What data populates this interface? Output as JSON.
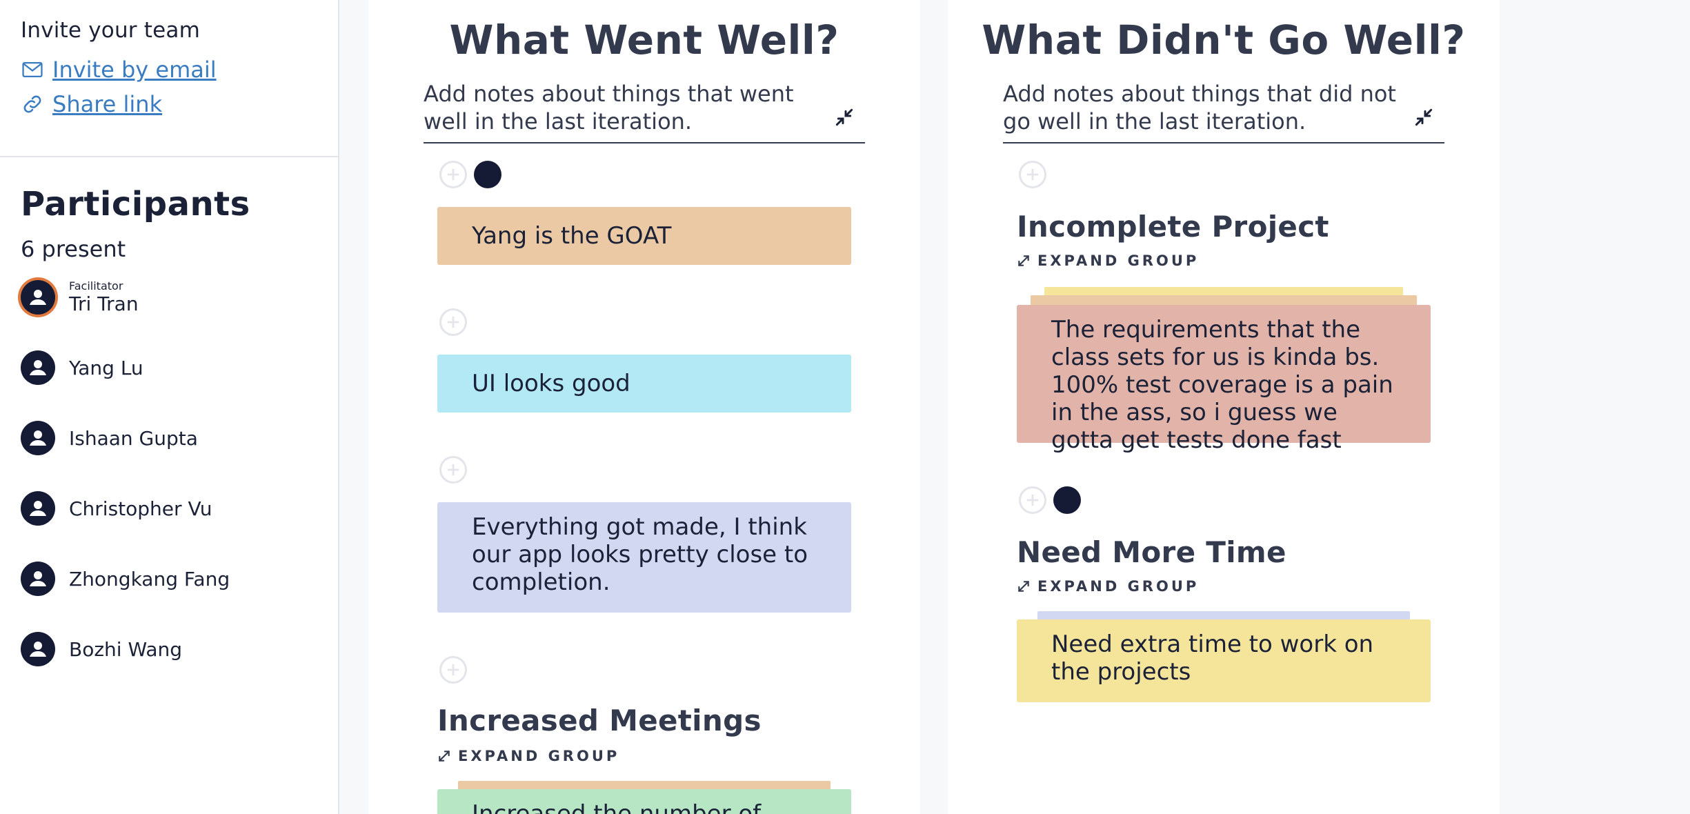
{
  "sidebar": {
    "invite": {
      "title": "Invite your team",
      "email_label": "Invite by email",
      "share_label": "Share link"
    },
    "participants": {
      "title": "Participants",
      "count_label": "6 present",
      "list": [
        {
          "role": "Facilitator",
          "name": "Tri Tran"
        },
        {
          "name": "Yang Lu"
        },
        {
          "name": "Ishaan Gupta"
        },
        {
          "name": "Christopher Vu"
        },
        {
          "name": "Zhongkang Fang"
        },
        {
          "name": "Bozhi Wang"
        }
      ]
    }
  },
  "columns": {
    "went_well": {
      "title": "What Went Well?",
      "description": "Add notes about things that went well in the last iteration.",
      "cards": [
        {
          "text": "Yang is the GOAT",
          "color": "#ebc9a4"
        },
        {
          "text": "UI looks good",
          "color": "#b3e8f5"
        },
        {
          "text": "Everything got made, I think our app looks pretty close to completion.",
          "color": "#d3d8f2"
        }
      ],
      "groups": [
        {
          "title": "Increased Meetings",
          "expand_label": "EXPAND GROUP",
          "preview_text": "Increased the number of",
          "color": "#b7e6c4",
          "stack_color": "#ebc9a4"
        }
      ]
    },
    "didnt_go_well": {
      "title": "What Didn't Go Well?",
      "description": "Add notes about things that did not go well in the last iteration.",
      "groups": [
        {
          "title": "Incomplete Project",
          "expand_label": "EXPAND GROUP",
          "card_text": "The requirements that the class sets for us is kinda bs. 100% test coverage is a pain in the ass, so i guess we gotta get tests done fast",
          "color": "#e2b3a8",
          "stack_colors": [
            "#f4e59a",
            "#ebc9a4"
          ]
        },
        {
          "title": "Need More Time",
          "expand_label": "EXPAND GROUP",
          "card_text": "Need extra time to work on the projects",
          "color": "#f5e59a",
          "stack_colors": [
            "#d3d8f2"
          ]
        }
      ]
    }
  },
  "colors": {
    "accent_link": "#3a7cc1",
    "facilitator_ring": "#e07a3f",
    "avatar_bg": "#151b35"
  }
}
